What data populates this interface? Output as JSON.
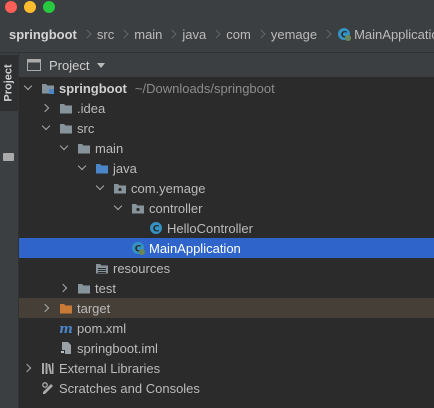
{
  "window": {
    "controls": [
      "close",
      "minimize",
      "maximize"
    ]
  },
  "breadcrumb": [
    {
      "label": "springboot",
      "bold": true
    },
    {
      "label": "src"
    },
    {
      "label": "main"
    },
    {
      "label": "java"
    },
    {
      "label": "com"
    },
    {
      "label": "yemage"
    },
    {
      "label": "MainApplication",
      "icon": "spring-class-icon"
    }
  ],
  "toolstrip": {
    "project_tab": "Project"
  },
  "panel": {
    "title": "Project"
  },
  "tree": [
    {
      "label": "springboot",
      "path": "~/Downloads/springboot",
      "icon": "module-folder-icon",
      "expanded": true
    },
    {
      "label": ".idea",
      "icon": "folder-icon",
      "expanded": false
    },
    {
      "label": "src",
      "icon": "folder-icon",
      "expanded": true
    },
    {
      "label": "main",
      "icon": "folder-icon",
      "expanded": true
    },
    {
      "label": "java",
      "icon": "source-folder-icon",
      "expanded": true
    },
    {
      "label": "com.yemage",
      "icon": "package-icon",
      "expanded": true
    },
    {
      "label": "controller",
      "icon": "package-icon",
      "expanded": true
    },
    {
      "label": "HelloController",
      "icon": "class-icon"
    },
    {
      "label": "MainApplication",
      "icon": "spring-class-icon",
      "selected": true
    },
    {
      "label": "resources",
      "icon": "resources-folder-icon"
    },
    {
      "label": "test",
      "icon": "folder-icon",
      "expanded": false
    },
    {
      "label": "target",
      "icon": "excluded-folder-icon",
      "expanded": false
    },
    {
      "label": "pom.xml",
      "icon": "maven-icon"
    },
    {
      "label": "springboot.iml",
      "icon": "iml-file-icon"
    },
    {
      "label": "External Libraries",
      "icon": "libraries-icon",
      "expanded": false
    },
    {
      "label": "Scratches and Consoles",
      "icon": "scratches-icon"
    }
  ],
  "colors": {
    "background": "#2b2b2b",
    "chrome": "#3c3f41",
    "selection": "#2f65ca",
    "excluded_row": "#453f38",
    "folder": "#87939a",
    "source_folder": "#4a86c8",
    "excluded_folder": "#c97a37",
    "class_icon": "#3592c4"
  }
}
